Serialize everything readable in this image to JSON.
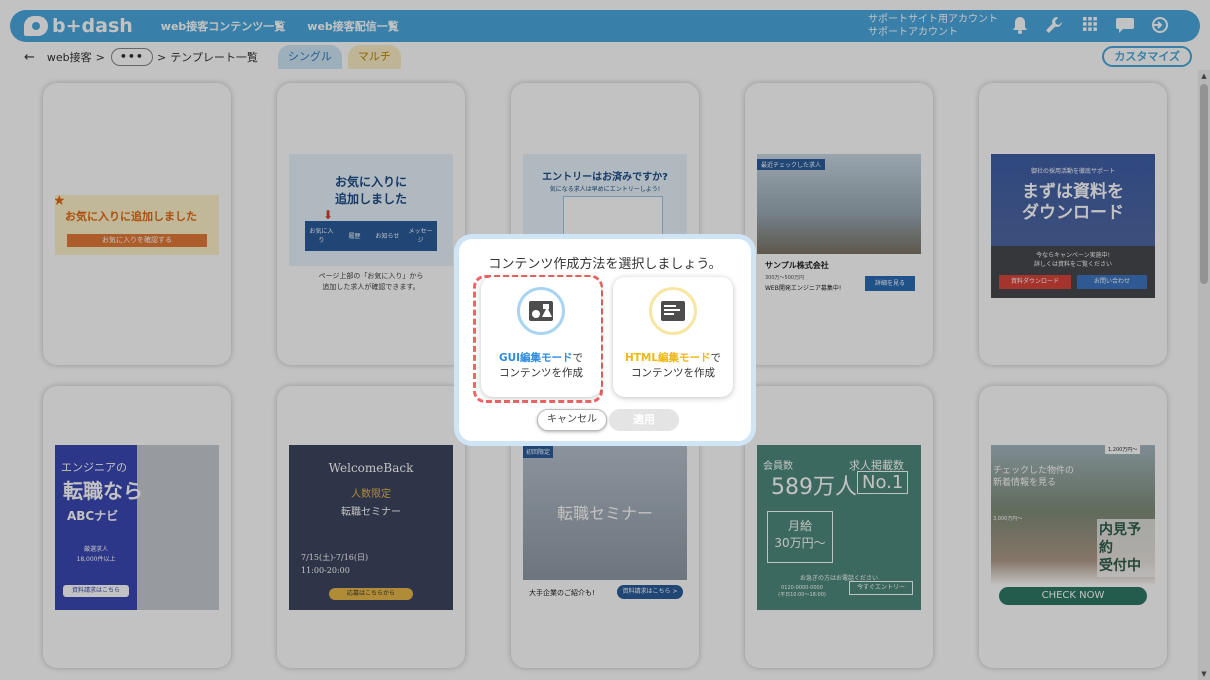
{
  "header": {
    "logo": "b+dash",
    "nav": [
      "web接客コンテンツ一覧",
      "web接客配信一覧"
    ],
    "account_line1": "サポートサイト用アカウント",
    "account_line2": "サポートアカウント",
    "icons": [
      "bell-icon",
      "wrench-icon",
      "grid-apps-icon",
      "chat-bubble-icon",
      "logout-icon"
    ],
    "colors": {
      "brand": "#4aa9df"
    }
  },
  "subbar": {
    "back": "←",
    "crumb1": "web接客",
    "sep": ">",
    "more": "•••",
    "crumb2": "テンプレート一覧",
    "tabs": [
      "シングル",
      "マルチ"
    ],
    "customize": "カスタマイズ"
  },
  "templates": {
    "t1": {
      "title": "お気に入りに追加しました",
      "star": "★",
      "button": "お気に入りを確認する"
    },
    "t2": {
      "title": "お気に入りに\n追加しました",
      "arrow": "⬇",
      "icons": [
        "お気に入り",
        "履歴",
        "お知らせ",
        "メッセージ"
      ],
      "caption": "ページ上部の「お気に入り」から\n追加した求人が確認できます。"
    },
    "t3": {
      "title": "エントリーはお済みですか?",
      "sub": "気になる求人は早めにエントリーしよう!"
    },
    "t4": {
      "tag": "最近チェックした求人",
      "company": "サンプル株式会社",
      "salary": "300万〜500万円",
      "job": "WEB開発エンジニア募集中!",
      "button": "詳細を見る"
    },
    "t5": {
      "sub": "御社の採用活動を徹底サポート",
      "title": "まずは資料を\nダウンロード",
      "note": "今ならキャンペーン実施中!\n詳しくは資料をご覧ください",
      "button1": "資料ダウンロード",
      "button2": "お問い合わせ"
    },
    "t6": {
      "a": "エンジニアの",
      "b": "転職なら",
      "c": "ABCナビ",
      "d": "厳選求人\n18,000件以上",
      "button": "資料請求はこちら"
    },
    "t7": {
      "a": "WelcomeBack",
      "b": "人数限定",
      "c": "転職セミナー",
      "d": "7/15(土)-7/16(日)\n11:00-20:00",
      "button": "応募はこちらから"
    },
    "t8": {
      "tag": "初回限定",
      "title": "転職セミナー",
      "foot": "大手企業のご紹介も!",
      "button": "資料請求はこちら >"
    },
    "t9": {
      "a": "会員数",
      "b": "589万人",
      "c": "求人掲載数",
      "d": "No.1",
      "e": "月給\n30万円〜",
      "f": "お急ぎの方はお電話ください",
      "g": "0120-0000-0000\n(平日10:00〜18:00)",
      "button": "今すぐエントリー"
    },
    "t10": {
      "a": "1,200万円〜",
      "b": "チェックした物件の\n新着情報を見る",
      "c": "3,000万円〜",
      "d": "内見予約\n受付中",
      "button": "CHECK NOW"
    }
  },
  "modal": {
    "title": "コンテンツ作成方法を選択しましょう。",
    "gui": {
      "mode": "GUI編集モード",
      "de": "で",
      "line2": "コンテンツを作成",
      "icon": "image-shapes-icon"
    },
    "html": {
      "mode": "HTML編集モード",
      "de": "で",
      "line2": "コンテンツを作成",
      "icon": "html-code-icon"
    },
    "cancel": "キャンセル",
    "apply": "適用",
    "colors": {
      "gui": "#2c8be0",
      "html": "#efb711",
      "highlight": "#ee6666"
    }
  }
}
